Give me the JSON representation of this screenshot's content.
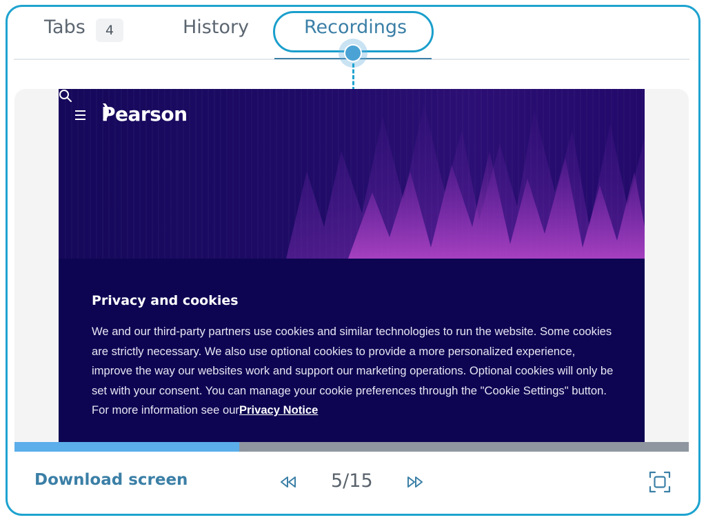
{
  "tabs": [
    {
      "label": "Tabs",
      "badge": "4"
    },
    {
      "label": "History"
    },
    {
      "label": "Recordings",
      "active": true
    }
  ],
  "recording": {
    "site": {
      "brand": "Pearson",
      "icons": [
        "menu-icon",
        "search-icon"
      ]
    },
    "cookie_banner": {
      "title": "Privacy and cookies",
      "body": "We and our third-party partners use cookies and similar technologies to run the website. Some cookies are strictly necessary. We also use optional cookies to provide a more personalized experience, improve the way our websites work and support our marketing operations. Optional cookies will only be set with your consent. You can manage your cookie preferences through the \"Cookie Settings\" button. For more information see our",
      "link": "Privacy Notice"
    }
  },
  "progress": {
    "fraction": 0.333
  },
  "footer": {
    "download_label": "Download screen",
    "current": 5,
    "total": 15,
    "counter": "5/15",
    "icons": [
      "rewind-icon",
      "fast-forward-icon",
      "fullscreen-icon"
    ]
  },
  "colors": {
    "accent": "#1ea3cf",
    "active_tab": "#3b7fa6",
    "progress_fill": "#5baeea",
    "progress_track": "#8f96a0",
    "banner_bg": "#0d0552"
  }
}
